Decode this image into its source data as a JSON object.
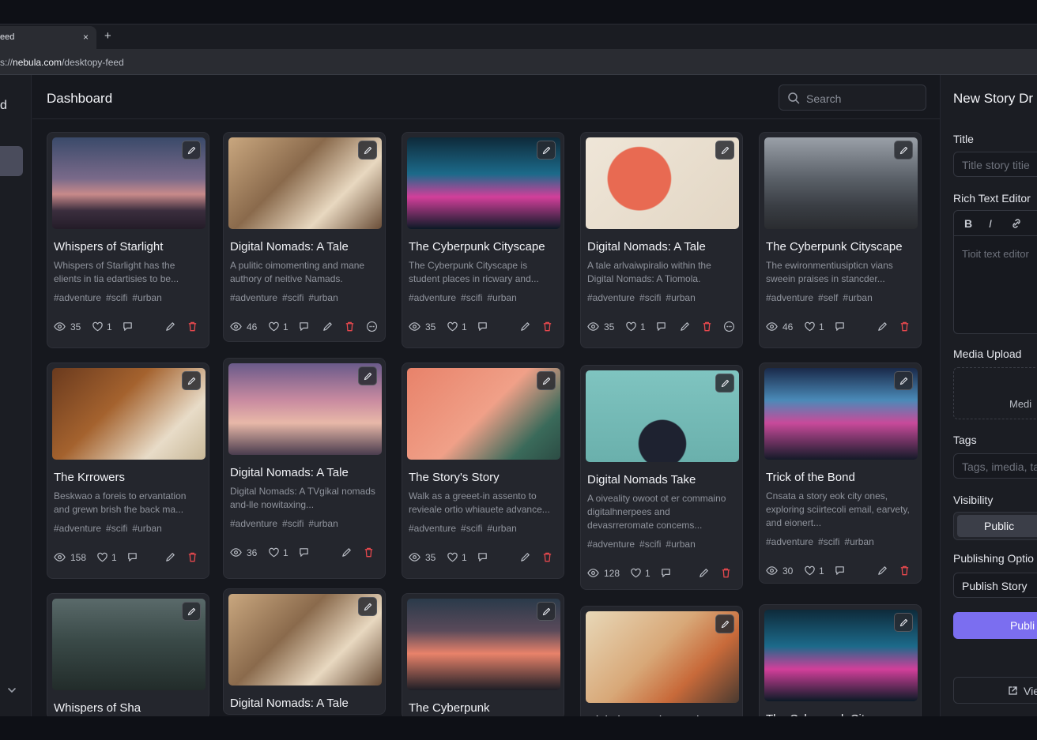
{
  "browser": {
    "tab_title": "eed",
    "tab_close": "×",
    "new_tab": "+",
    "url_prefix": "s://",
    "url_domain": "nebula.com",
    "url_path": "/desktopy-feed"
  },
  "sidebar": {
    "letter": "d"
  },
  "header": {
    "title": "Dashboard",
    "search_placeholder": "Search"
  },
  "cards": [
    {
      "title": "Whispers of Starlight",
      "desc": "Whispers of Starlight has the elients in tia edartisies to be...",
      "tags": [
        "#adventure",
        "#scifi",
        "#urban"
      ],
      "views": "35",
      "likes": "1",
      "more": false,
      "tint": "night-mountains"
    },
    {
      "title": "Digital Nomads: A Tale",
      "desc": "A pulitic oimomenting and mane authory of neitive Namads.",
      "tags": [
        "#adventure",
        "#scifi",
        "#urban"
      ],
      "views": "46",
      "likes": "1",
      "more": true,
      "tint": "cafe"
    },
    {
      "title": "The Cyberpunk Cityscape",
      "desc": "The Cyberpunk Cityscape is student places in ricwary and...",
      "tags": [
        "#adventure",
        "#scifi",
        "#urban"
      ],
      "views": "35",
      "likes": "1",
      "more": false,
      "tint": "neon-street"
    },
    {
      "title": "Digital Nomads: A Tale",
      "desc": "A tale arlvaiwpiralio within the Digital Nomads: A Tiomola.",
      "tags": [
        "#adventure",
        "#scifi",
        "#urban"
      ],
      "views": "35",
      "likes": "1",
      "more": true,
      "tint": "poster"
    },
    {
      "title": "The Cyberpunk Cityscape",
      "desc": "The ewironmentiusipticn vians sweein praises in stancder...",
      "tags": [
        "#adventure",
        "#self",
        "#urban"
      ],
      "views": "46",
      "likes": "1",
      "more": false,
      "tint": "gray-city"
    },
    {
      "title": "The Krrowers",
      "desc": "Beskwao a foreis to ervantation and grewn brish the back ma...",
      "tags": [
        "#adventure",
        "#scifi",
        "#urban"
      ],
      "views": "158",
      "likes": "1",
      "more": false,
      "tint": "writing"
    },
    {
      "title": "Digital Nomads: A Tale",
      "desc": "Digital Nomads: A TVgikal nomads and-lle nowitaxing...",
      "tags": [
        "#adventure",
        "#scifi",
        "#urban"
      ],
      "views": "36",
      "likes": "1",
      "more": false,
      "tint": "desert-window"
    },
    {
      "title": "The Story's Story",
      "desc": "Walk as a greeet-in assento to revieale ortio whiauete advance...",
      "tags": [
        "#adventure",
        "#scifi",
        "#urban"
      ],
      "views": "35",
      "likes": "1",
      "more": false,
      "tint": "salmon-woman"
    },
    {
      "title": "Digital Nomads Take",
      "desc": "A oiveality owoot ot er commaino digitalhnerpees and devasrreromate concems...",
      "tags": [
        "#adventure",
        "#scifi",
        "#urban"
      ],
      "views": "128",
      "likes": "1",
      "more": false,
      "tint": "teal-figure"
    },
    {
      "title": "Trick of the Bond",
      "desc": "Cnsata a story eok city ones, exploring sciirtecoli email, earvety, and eionert...",
      "tags": [
        "#adventure",
        "#scifi",
        "#urban"
      ],
      "views": "30",
      "likes": "1",
      "more": false,
      "tint": "neon-alley"
    },
    {
      "title": "Whispers of Sha",
      "desc": "",
      "tags": [],
      "views": "",
      "likes": "",
      "more": false,
      "tint": "forest"
    },
    {
      "title": "Digital Nomads: A Tale",
      "desc": "",
      "tags": [],
      "views": "",
      "likes": "",
      "more": false,
      "tint": "cafe"
    },
    {
      "title": "The Cyberpunk",
      "desc": "",
      "tags": [],
      "views": "",
      "likes": "",
      "more": false,
      "tint": "canyon"
    },
    {
      "title": "Digital Nomads: A Tale",
      "desc": "",
      "tags": [],
      "views": "",
      "likes": "",
      "more": false,
      "tint": "comic"
    },
    {
      "title": "The Cyberpunk Cityscape",
      "desc": "",
      "tags": [],
      "views": "",
      "likes": "",
      "more": false,
      "tint": "neon-street"
    }
  ],
  "panel": {
    "title": "New Story Dr",
    "title_label": "Title",
    "title_placeholder": "Title story titie",
    "rte_label": "Rich Text Editor",
    "rte_bold": "B",
    "rte_italic": "I",
    "rte_placeholder": "Tioit text editor",
    "media_label": "Media Upload",
    "media_text": "Medi",
    "tags_label": "Tags",
    "tags_placeholder": "Tags, imedia, ta",
    "visibility_label": "Visibility",
    "visibility_value": "Public",
    "publishing_label": "Publishing Optio",
    "publishing_value": "Publish Story",
    "publish_button": "Publi",
    "view_button": "Vie"
  },
  "colors": {
    "accent": "#7b6ef0",
    "delete": "#e5484d",
    "card_bg": "#24262d"
  }
}
